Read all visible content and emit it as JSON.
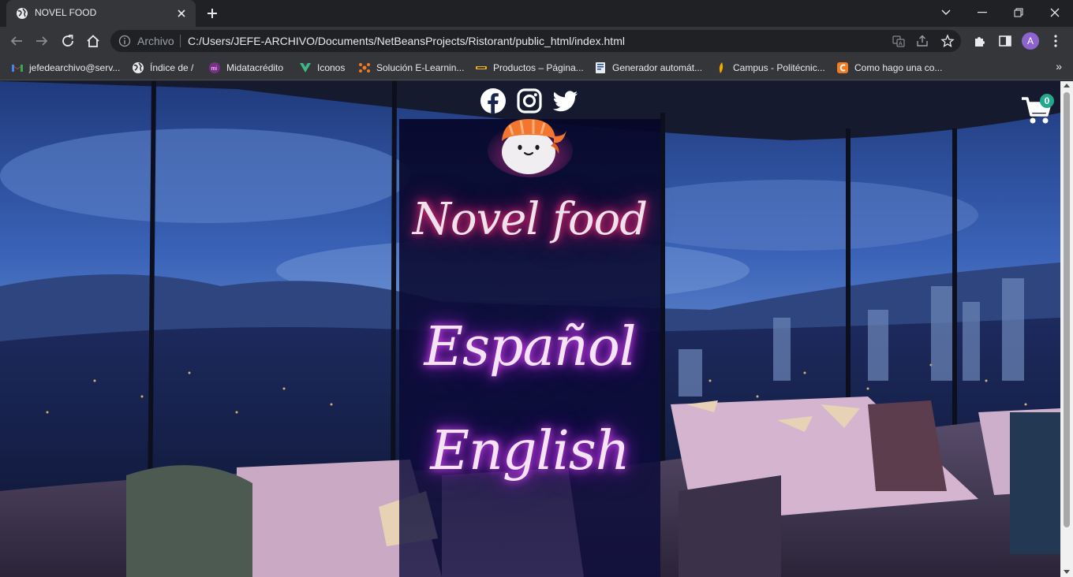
{
  "browser": {
    "tab": {
      "title": "NOVEL FOOD"
    },
    "address": {
      "scheme": "Archivo",
      "url": "C:/Users/JEFE-ARCHIVO/Documents/NetBeansProjects/Ristorant/public_html/index.html"
    },
    "profile_initial": "A",
    "bookmarks": [
      {
        "label": "jefedearchivo@serv...",
        "icon": "gmail-icon"
      },
      {
        "label": "Índice de /",
        "icon": "globe-icon"
      },
      {
        "label": "Midatacrédito",
        "icon": "midatacredito-icon"
      },
      {
        "label": "Iconos",
        "icon": "vue-icon"
      },
      {
        "label": "Solución E-Learnin...",
        "icon": "elearning-icon"
      },
      {
        "label": "Productos – Página...",
        "icon": "products-icon"
      },
      {
        "label": "Generador automát...",
        "icon": "document-icon"
      },
      {
        "label": "Campus - Politécnic...",
        "icon": "campus-icon"
      },
      {
        "label": "Como hago una co...",
        "icon": "c-icon"
      }
    ]
  },
  "page": {
    "social": [
      "facebook-icon",
      "instagram-icon",
      "twitter-icon"
    ],
    "cart": {
      "count": "0"
    },
    "brand": "Novel food",
    "languages": [
      "Español",
      "English"
    ]
  },
  "colors": {
    "accent_pink": "#ff2e7e",
    "accent_purple": "#e048ff",
    "cart_badge": "#23a78f"
  }
}
